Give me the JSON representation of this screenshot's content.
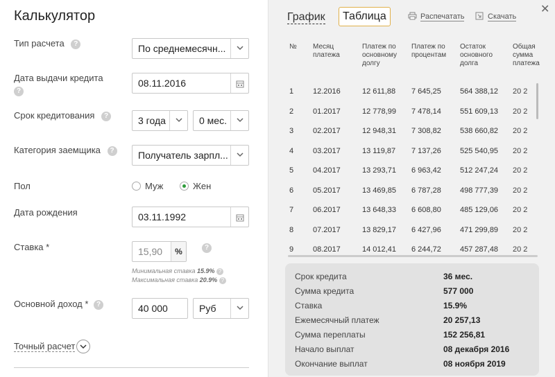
{
  "calc": {
    "title": "Калькулятор",
    "type_label": "Тип расчета",
    "type_value": "По среднемесячн...",
    "date_issue_label": "Дата выдачи кредита",
    "date_issue_value": "08.11.2016",
    "term_label": "Срок кредитования",
    "term_years": "3 года",
    "term_months": "0 мес.",
    "category_label": "Категория заемщика",
    "category_value": "Получатель зарпл...",
    "gender_label": "Пол",
    "gender_male": "Муж",
    "gender_female": "Жен",
    "gender_selected": "Жен",
    "birth_label": "Дата рождения",
    "birth_value": "03.11.1992",
    "rate_label": "Ставка *",
    "rate_value": "15,90",
    "rate_unit": "%",
    "min_rate_text": "Минимальная ставка",
    "min_rate_value": "15.9%",
    "max_rate_text": "Максимальная ставка",
    "max_rate_value": "20.9%",
    "income_label": "Основной доход *",
    "income_value": "40 000",
    "currency_value": "Руб",
    "exact_label": "Точный расчет"
  },
  "panel": {
    "tab_graph": "График",
    "tab_table": "Таблица",
    "print_label": "Распечатать",
    "download_label": "Скачать",
    "close_glyph": "✕"
  },
  "table": {
    "headers": [
      "№",
      "Месяц\nплатежа",
      "Платеж по\nосновному\nдолгу",
      "Платеж по\nпроцентам",
      "Остаток\nосновного\nдолга",
      "Общая\nсумма\nплатежа"
    ],
    "rows": [
      [
        "1",
        "12.2016",
        "12 611,88",
        "7 645,25",
        "564 388,12",
        "20 2"
      ],
      [
        "2",
        "01.2017",
        "12 778,99",
        "7 478,14",
        "551 609,13",
        "20 2"
      ],
      [
        "3",
        "02.2017",
        "12 948,31",
        "7 308,82",
        "538 660,82",
        "20 2"
      ],
      [
        "4",
        "03.2017",
        "13 119,87",
        "7 137,26",
        "525 540,95",
        "20 2"
      ],
      [
        "5",
        "04.2017",
        "13 293,71",
        "6 963,42",
        "512 247,24",
        "20 2"
      ],
      [
        "6",
        "05.2017",
        "13 469,85",
        "6 787,28",
        "498 777,39",
        "20 2"
      ],
      [
        "7",
        "06.2017",
        "13 648,33",
        "6 608,80",
        "485 129,06",
        "20 2"
      ],
      [
        "8",
        "07.2017",
        "13 829,17",
        "6 427,96",
        "471 299,89",
        "20 2"
      ],
      [
        "9",
        "08.2017",
        "14 012,41",
        "6 244,72",
        "457 287,48",
        "20 2"
      ]
    ]
  },
  "summary": [
    {
      "label": "Срок кредита",
      "value": "36 мес."
    },
    {
      "label": "Сумма кредита",
      "value": "577 000"
    },
    {
      "label": "Ставка",
      "value": "15.9%"
    },
    {
      "label": "Ежемесячный платеж",
      "value": "20 257,13"
    },
    {
      "label": "Сумма переплаты",
      "value": "152 256,81"
    },
    {
      "label": "Начало выплат",
      "value": "08 декабря 2016"
    },
    {
      "label": "Окончание выплат",
      "value": "08 ноября 2019"
    }
  ],
  "colors": {
    "accent_tab_border": "#e0b04a",
    "radio_selected": "#2e9c3a",
    "panel_bg": "#f1f1f1",
    "summary_bg": "#e2e2e2"
  }
}
